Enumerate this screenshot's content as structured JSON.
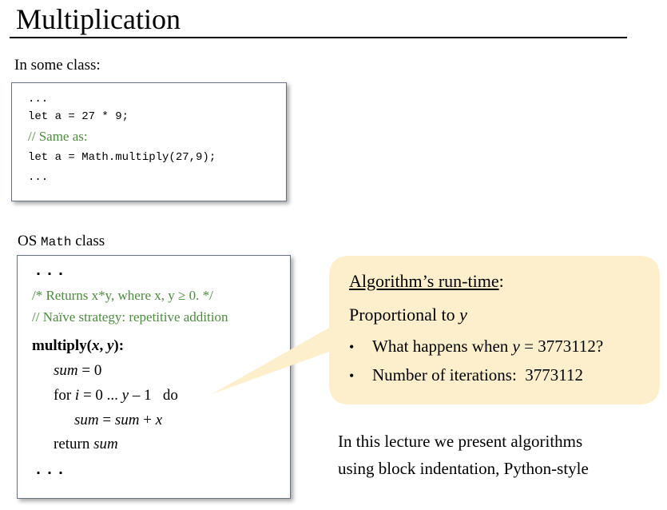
{
  "slide": {
    "title": "Multiplication"
  },
  "section1": {
    "label": "In some class:",
    "code": {
      "line1": "...",
      "line2": "let a = 27 * 9;",
      "comment": "// Same as:",
      "line4": "let a = Math.multiply(27,9);",
      "line5": "..."
    }
  },
  "section2": {
    "label_prefix": "OS ",
    "label_code": "Math",
    "label_suffix": " class",
    "dots_top": "...",
    "comment1": "/* Returns x*y, where x, y ≥ 0. */",
    "comment2": "// Naïve strategy: repetitive addition",
    "signature": "multiply(x, y):",
    "sum_init": "sum = 0",
    "for_loop": "for i = 0 ... y – 1   do",
    "sum_update": "sum = sum + x",
    "return_stmt": "return sum",
    "dots_bottom": "..."
  },
  "callout": {
    "title": "Algorithm’s run-time",
    "colon": ":",
    "proportional_prefix": "Proportional to ",
    "proportional_var": "y",
    "bullet1_prefix": "What happens when ",
    "bullet1_var": "y",
    "bullet1_suffix": " = 3773112?",
    "bullet2": "Number of iterations:  3773112",
    "bullet_char": "•",
    "fill_color": "#fdefcc"
  },
  "footer": {
    "line1": "In this lecture we present algorithms",
    "line2": "using block indentation, Python-style"
  }
}
